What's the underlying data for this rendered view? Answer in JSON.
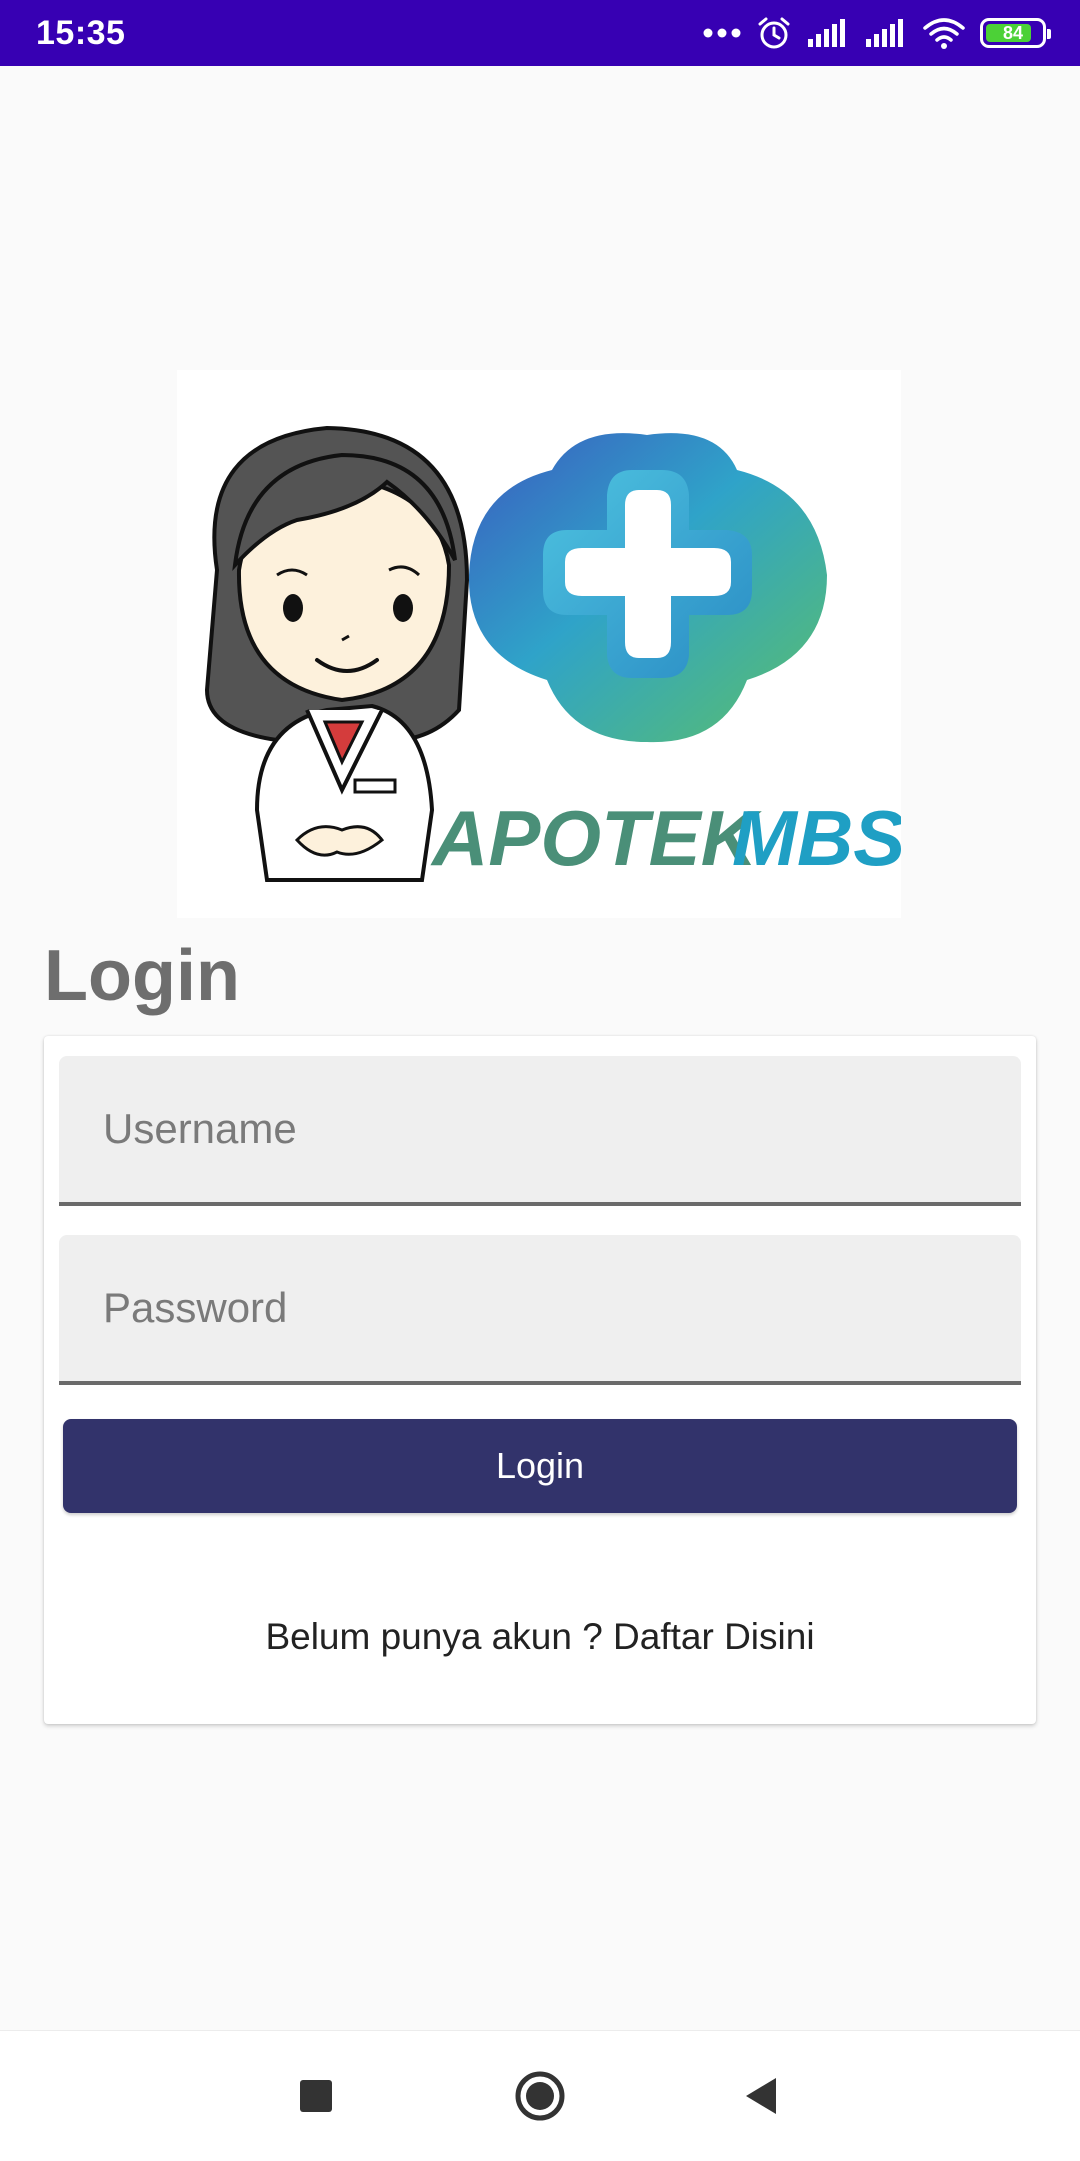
{
  "status_bar": {
    "time": "15:35",
    "battery_level": "84",
    "battery_fraction": 0.84,
    "icons": [
      "more-dots-icon",
      "alarm-icon",
      "signal-icon",
      "signal-icon",
      "wifi-icon",
      "battery-icon"
    ]
  },
  "logo": {
    "text_apotek": "APOTEK",
    "text_mbs": "MBS",
    "colors": {
      "apotek": "#4a8f78",
      "mbs": "#1f9fc4",
      "cross_outer": "#2fa3c9",
      "cross_inner": "#ffffff"
    }
  },
  "login_form": {
    "title": "Login",
    "username_placeholder": "Username",
    "password_placeholder": "Password",
    "login_button": "Login",
    "register_link": "Belum punya akun ? Daftar Disini"
  },
  "colors": {
    "status_bar": "#3700b3",
    "button": "#32336b",
    "title_text": "#6e6e6e",
    "field_background": "#efefef"
  },
  "nav_bar": {
    "buttons": [
      "recent-apps-icon",
      "home-icon",
      "back-icon"
    ]
  }
}
